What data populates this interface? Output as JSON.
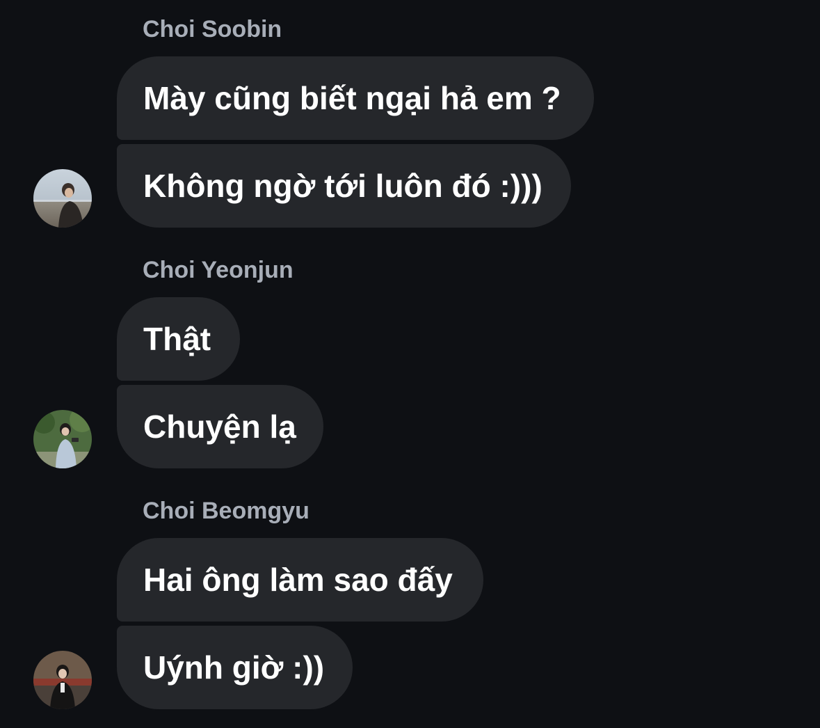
{
  "groups": [
    {
      "sender": "Choi Soobin",
      "avatar_icon": "avatar-photo-soobin",
      "messages": [
        "Mày cũng biết ngại hả em ?",
        "Không ngờ tới luôn đó :)))"
      ]
    },
    {
      "sender": "Choi Yeonjun",
      "avatar_icon": "avatar-photo-yeonjun",
      "messages": [
        "Thật",
        "Chuyện lạ"
      ]
    },
    {
      "sender": "Choi Beomgyu",
      "avatar_icon": "avatar-photo-beomgyu",
      "messages": [
        "Hai ông làm sao đấy",
        "Uýnh giờ :))"
      ]
    }
  ],
  "colors": {
    "background": "#0e1014",
    "bubble": "#25272b",
    "message_text": "#ffffff",
    "sender_text": "#a8aeb8"
  }
}
